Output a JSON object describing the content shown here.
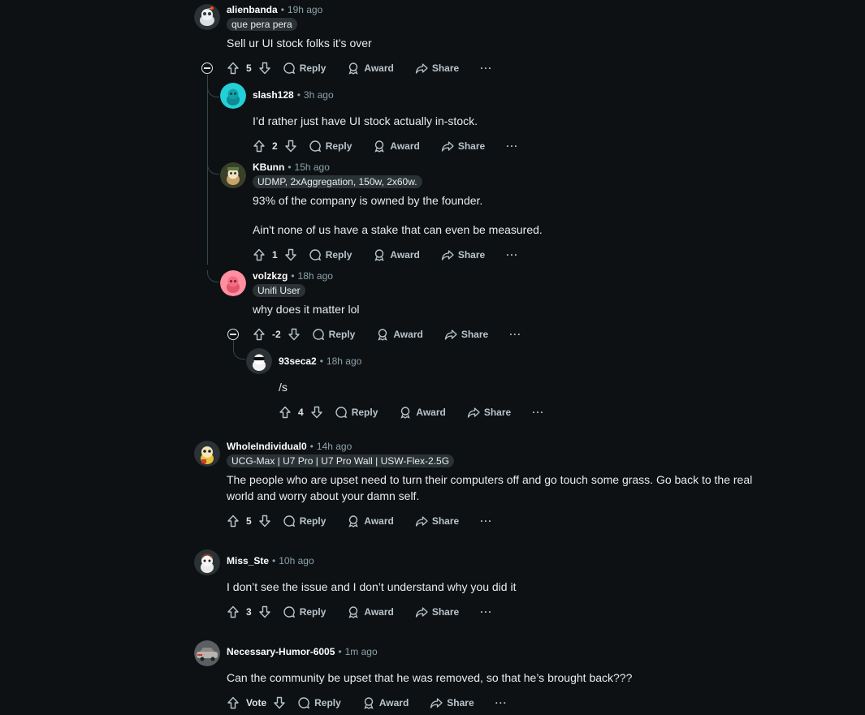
{
  "actions": {
    "reply": "Reply",
    "award": "Award",
    "share": "Share",
    "more": "···"
  },
  "comments": [
    {
      "author": "alienbanda",
      "age": "19h ago",
      "flair": "que pera pera",
      "body": "Sell ur UI stock folks it’s over",
      "score": "5"
    },
    {
      "author": "slash128",
      "age": "3h ago",
      "body": "I’d rather just have UI stock actually in-stock.",
      "score": "2"
    },
    {
      "author": "KBunn",
      "age": "15h ago",
      "flair": "UDMP, 2xAggregation, 150w, 2x60w.",
      "body": "93% of the company is owned by the founder.",
      "body2": "Ain't none of us have a stake that can even be measured.",
      "score": "1"
    },
    {
      "author": "volzkzg",
      "age": "18h ago",
      "flair": "Unifi User",
      "body": "why does it matter lol",
      "score": "-2"
    },
    {
      "author": "93seca2",
      "age": "18h ago",
      "body": "/s",
      "score": "4"
    },
    {
      "author": "WholeIndividual0",
      "age": "14h ago",
      "flair": "UCG-Max | U7 Pro | U7 Pro Wall | USW-Flex-2.5G",
      "body": "The people who are upset need to turn their computers off and go touch some grass. Go back to the real world and worry about your damn self.",
      "score": "5"
    },
    {
      "author": "Miss_Ste",
      "age": "10h ago",
      "body": "I don’t see the issue and I don’t understand why you did it",
      "score": "3"
    },
    {
      "author": "Necessary-Humor-6005",
      "age": "1m ago",
      "body": "Can the community be upset that he was removed, so that he’s brought back???",
      "score": "Vote"
    }
  ]
}
